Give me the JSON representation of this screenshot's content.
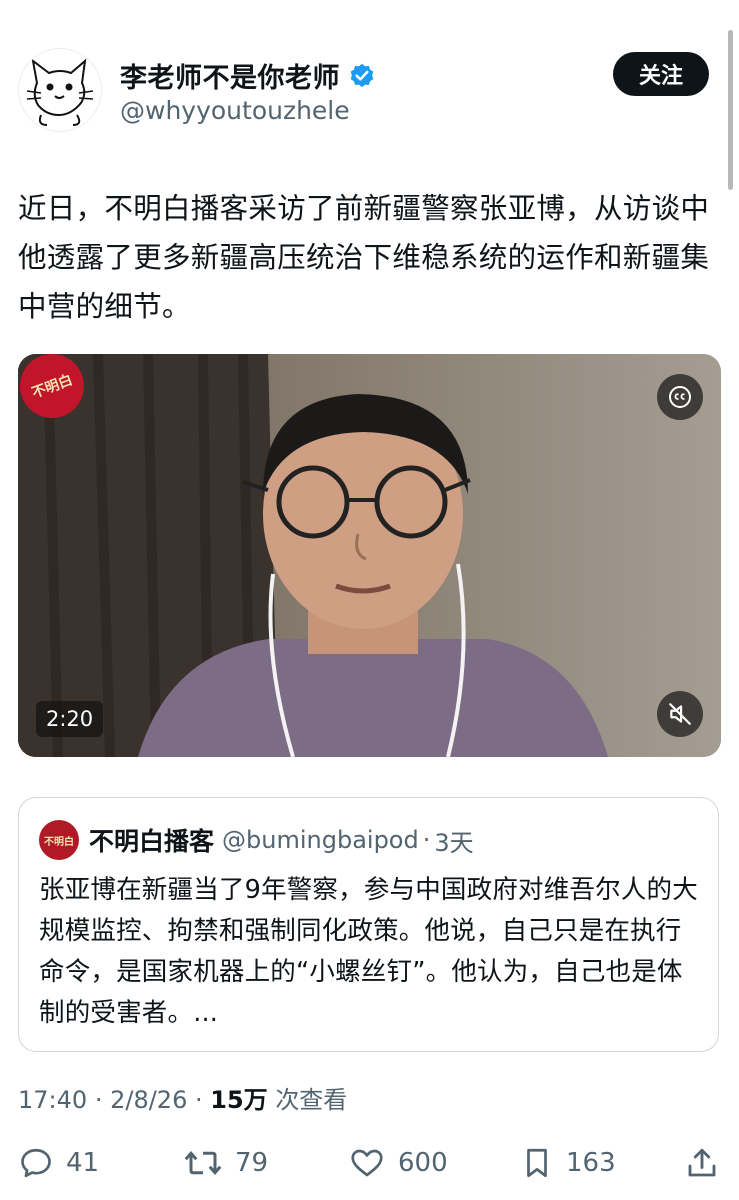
{
  "author": {
    "display_name": "李老师不是你老师",
    "handle": "@whyyoutouzhele",
    "verified": true,
    "follow_label": "关注"
  },
  "tweet": {
    "text": "近日，不明白播客采访了前新疆警察张亚博，从访谈中他透露了更多新疆高压统治下维稳系统的运作和新疆集中营的细节。"
  },
  "media": {
    "type": "video",
    "channel_badge": "不明白",
    "duration": "2:20",
    "icons": [
      "closed-captions-icon",
      "muted-speaker-icon"
    ]
  },
  "quote": {
    "avatar_text": "不明白",
    "display_name": "不明白播客",
    "handle": "@bumingbaipod",
    "separator": "·",
    "time": "3天",
    "text": "张亚博在新疆当了9年警察，参与中国政府对维吾尔人的大规模监控、拘禁和强制同化政策。他说，自己只是在执行命令，是国家机器上的“小螺丝钉”。他认为，自己也是体制的受害者。..."
  },
  "meta": {
    "time": "17:40",
    "dot1": "·",
    "date": "2/8/26",
    "dot2": "·",
    "views_count": "15万",
    "views_label": "次查看"
  },
  "actions": {
    "replies": "41",
    "retweets": "79",
    "likes": "600",
    "bookmarks": "163"
  },
  "colors": {
    "text": "#0f1419",
    "secondary": "#536471",
    "verified_blue": "#1d9bf0",
    "border": "#cfd9de",
    "badge_red": "#c0152a"
  }
}
